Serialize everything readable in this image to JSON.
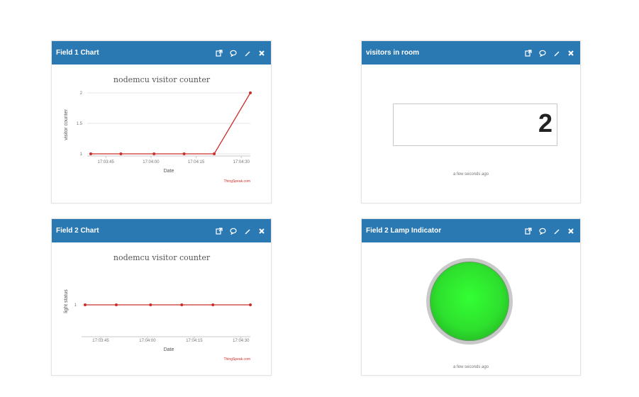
{
  "widgets": {
    "field1_chart": {
      "title": "Field 1 Chart",
      "chart_title": "nodemcu visitor counter",
      "ylabel": "visitor counter",
      "xlabel": "Date",
      "credit": "ThingSpeak.com"
    },
    "visitors": {
      "title": "visitors in room",
      "value": "2",
      "updated": "a few seconds ago"
    },
    "field2_chart": {
      "title": "Field 2 Chart",
      "chart_title": "nodemcu visitor counter",
      "ylabel": "light status",
      "xlabel": "Date",
      "credit": "ThingSpeak.com"
    },
    "lamp": {
      "title": "Field 2 Lamp Indicator",
      "updated": "a few seconds ago",
      "state": "on",
      "color": "#33ff33"
    }
  },
  "colors": {
    "header": "#2a79b2",
    "series": "#c9302c",
    "grid": "#e6e6e6"
  },
  "icons": [
    "external-link-icon",
    "comment-icon",
    "pencil-icon",
    "close-icon"
  ],
  "chart_data": [
    {
      "type": "line",
      "title": "nodemcu visitor counter",
      "xlabel": "Date",
      "ylabel": "visitor counter",
      "x": [
        "17:03:40",
        "17:03:50",
        "17:04:01",
        "17:04:11",
        "17:04:21",
        "17:04:33"
      ],
      "x_ticks": [
        "17:03:45",
        "17:04:00",
        "17:04:15",
        "17:04:30"
      ],
      "y_ticks": [
        1,
        1.5,
        2
      ],
      "ylim": [
        1,
        2
      ],
      "values": [
        1,
        1,
        1,
        1,
        1,
        2
      ],
      "grid": true
    },
    {
      "type": "line",
      "title": "nodemcu visitor counter",
      "xlabel": "Date",
      "ylabel": "light status",
      "x": [
        "17:03:40",
        "17:03:50",
        "17:04:01",
        "17:04:11",
        "17:04:21",
        "17:04:33"
      ],
      "x_ticks": [
        "17:03:45",
        "17:04:00",
        "17:04:15",
        "17:04:30"
      ],
      "y_ticks": [
        1
      ],
      "ylim": [
        0.5,
        1.5
      ],
      "values": [
        1,
        1,
        1,
        1,
        1,
        1
      ],
      "grid": true
    }
  ]
}
